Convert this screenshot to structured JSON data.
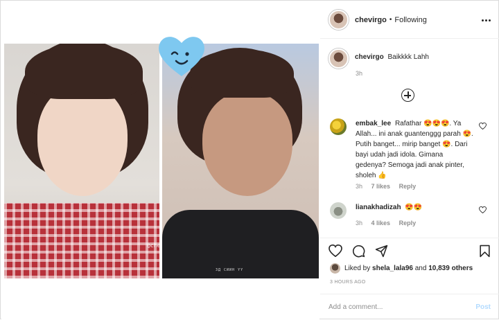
{
  "post": {
    "username": "chevirgo",
    "separator": "•",
    "follow_status": "Following",
    "watermark": "@chevirgo",
    "caption_user": "chevirgo",
    "caption_text": "Baikkkk Lahh",
    "caption_time": "3h",
    "video_caption": "ЗД СИИН ҮҮ"
  },
  "comments": [
    {
      "user": "embak_lee",
      "text": "Rafathar 😍😍😍. Ya Allah... ini anak guantenggg parah 😍. Putih banget... mirip banget 😍. Dari bayi udah jadi idola. Gimana gedenya? Semoga jadi anak pinter, sholeh 👍",
      "time": "3h",
      "likes": "7 likes",
      "reply": "Reply"
    },
    {
      "user": "lianakhadizah",
      "text": "😍😍",
      "time": "3h",
      "likes": "4 likes",
      "reply": "Reply"
    }
  ],
  "footer": {
    "liked_prefix": "Liked by",
    "liked_user": "shela_lala96",
    "liked_and": "and",
    "liked_count": "10,839 others",
    "time_ago": "3 HOURS AGO",
    "add_comment_placeholder": "Add a comment...",
    "post_label": "Post"
  },
  "icons": {
    "more": "more-options-icon",
    "new_comments": "plus-circle-icon",
    "like": "heart-icon",
    "comment": "comment-icon",
    "share": "paper-plane-icon",
    "save": "bookmark-icon"
  },
  "colors": {
    "text": "#262626",
    "muted": "#8e8e8e",
    "border": "#dbdbdb",
    "post_button": "#b3dbff",
    "heart_sticker": "#7ec8f0"
  }
}
